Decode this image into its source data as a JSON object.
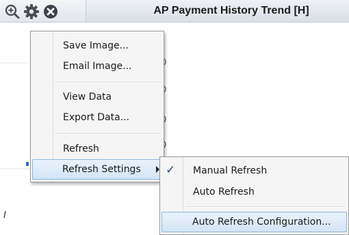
{
  "toolbar": {
    "icons": [
      "zoom-in-icon",
      "gear-icon",
      "close-icon"
    ]
  },
  "chart": {
    "title": "AP Payment History Trend [H]"
  },
  "context_menu": {
    "items": [
      {
        "label": "Save Image..."
      },
      {
        "label": "Email Image..."
      },
      {
        "label": "View Data"
      },
      {
        "label": "Export Data..."
      },
      {
        "label": "Refresh"
      },
      {
        "label": "Refresh Settings",
        "has_submenu": true,
        "highlighted": true
      }
    ]
  },
  "submenu": {
    "items": [
      {
        "label": "Manual Refresh",
        "checked": true
      },
      {
        "label": "Auto Refresh",
        "checked": false
      },
      {
        "label": "Auto Refresh Configuration...",
        "highlighted": true
      }
    ]
  },
  "colors": {
    "highlight_border": "#8fb5dc",
    "check": "#1a4f9c",
    "chart_series": "#2f6fc4"
  }
}
